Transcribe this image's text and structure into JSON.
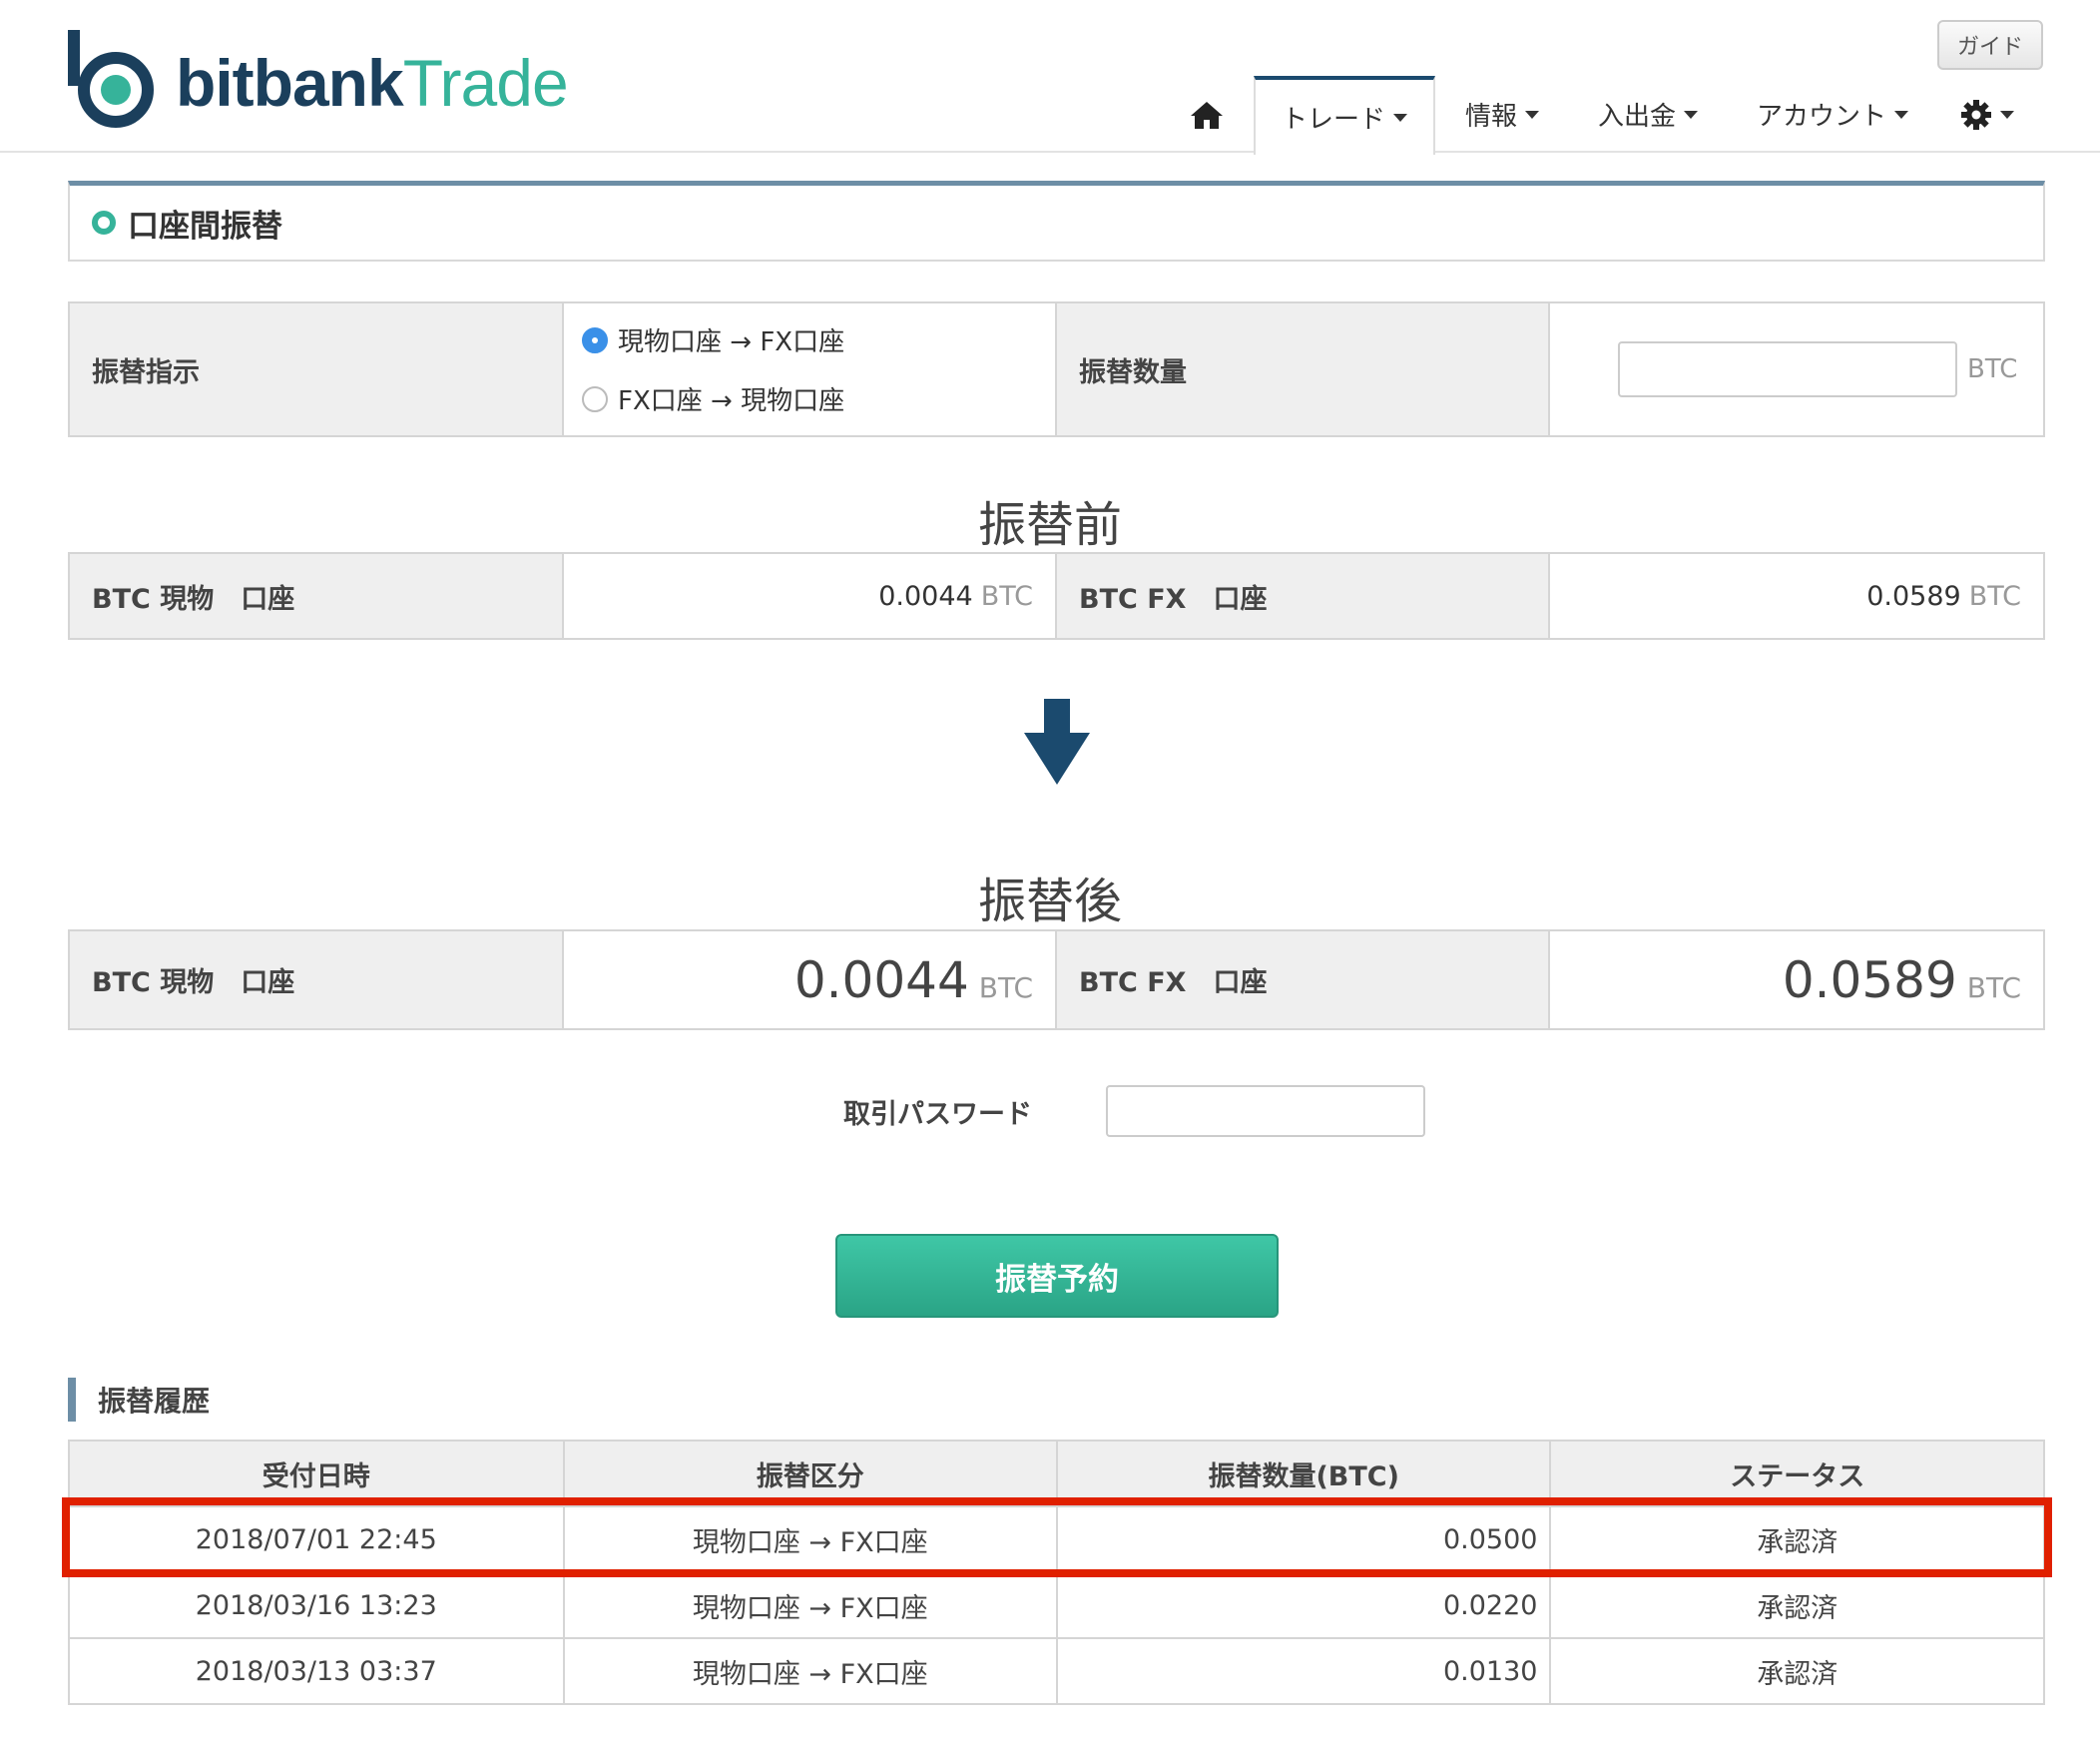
{
  "brand": {
    "name_bold": "bitbank",
    "name_light": "Trade",
    "colors": {
      "navy": "#1b3f5c",
      "teal": "#36b39a"
    }
  },
  "header": {
    "guide_label": "ガイド",
    "nav": {
      "home_icon": "home-icon",
      "trade": "トレード",
      "info": "情報",
      "deposit": "入出金",
      "account": "アカウント",
      "settings_icon": "gear-icon"
    }
  },
  "page": {
    "title": "口座間振替"
  },
  "transfer_form": {
    "direction_label": "振替指示",
    "options": [
      {
        "label": "現物口座 → FX口座",
        "selected": true
      },
      {
        "label": "FX口座 → 現物口座",
        "selected": false
      }
    ],
    "amount_label": "振替数量",
    "amount_value": "",
    "amount_unit": "BTC"
  },
  "before": {
    "heading": "振替前",
    "spot_label": "BTC 現物　口座",
    "spot_value": "0.0044",
    "fx_label": "BTC FX　口座",
    "fx_value": "0.0589",
    "unit": "BTC"
  },
  "after": {
    "heading": "振替後",
    "spot_label": "BTC 現物　口座",
    "spot_value": "0.0044",
    "fx_label": "BTC FX　口座",
    "fx_value": "0.0589",
    "unit": "BTC"
  },
  "password": {
    "label": "取引パスワード",
    "value": ""
  },
  "submit_label": "振替予約",
  "history": {
    "heading": "振替履歴",
    "columns": [
      "受付日時",
      "振替区分",
      "振替数量(BTC)",
      "ステータス"
    ],
    "rows": [
      [
        "2018/07/01 22:45",
        "現物口座 → FX口座",
        "0.0500",
        "承認済"
      ],
      [
        "2018/03/16 13:23",
        "現物口座 → FX口座",
        "0.0220",
        "承認済"
      ],
      [
        "2018/03/13 03:37",
        "現物口座 → FX口座",
        "0.0130",
        "承認済"
      ]
    ],
    "highlight_color": "#e02000"
  }
}
